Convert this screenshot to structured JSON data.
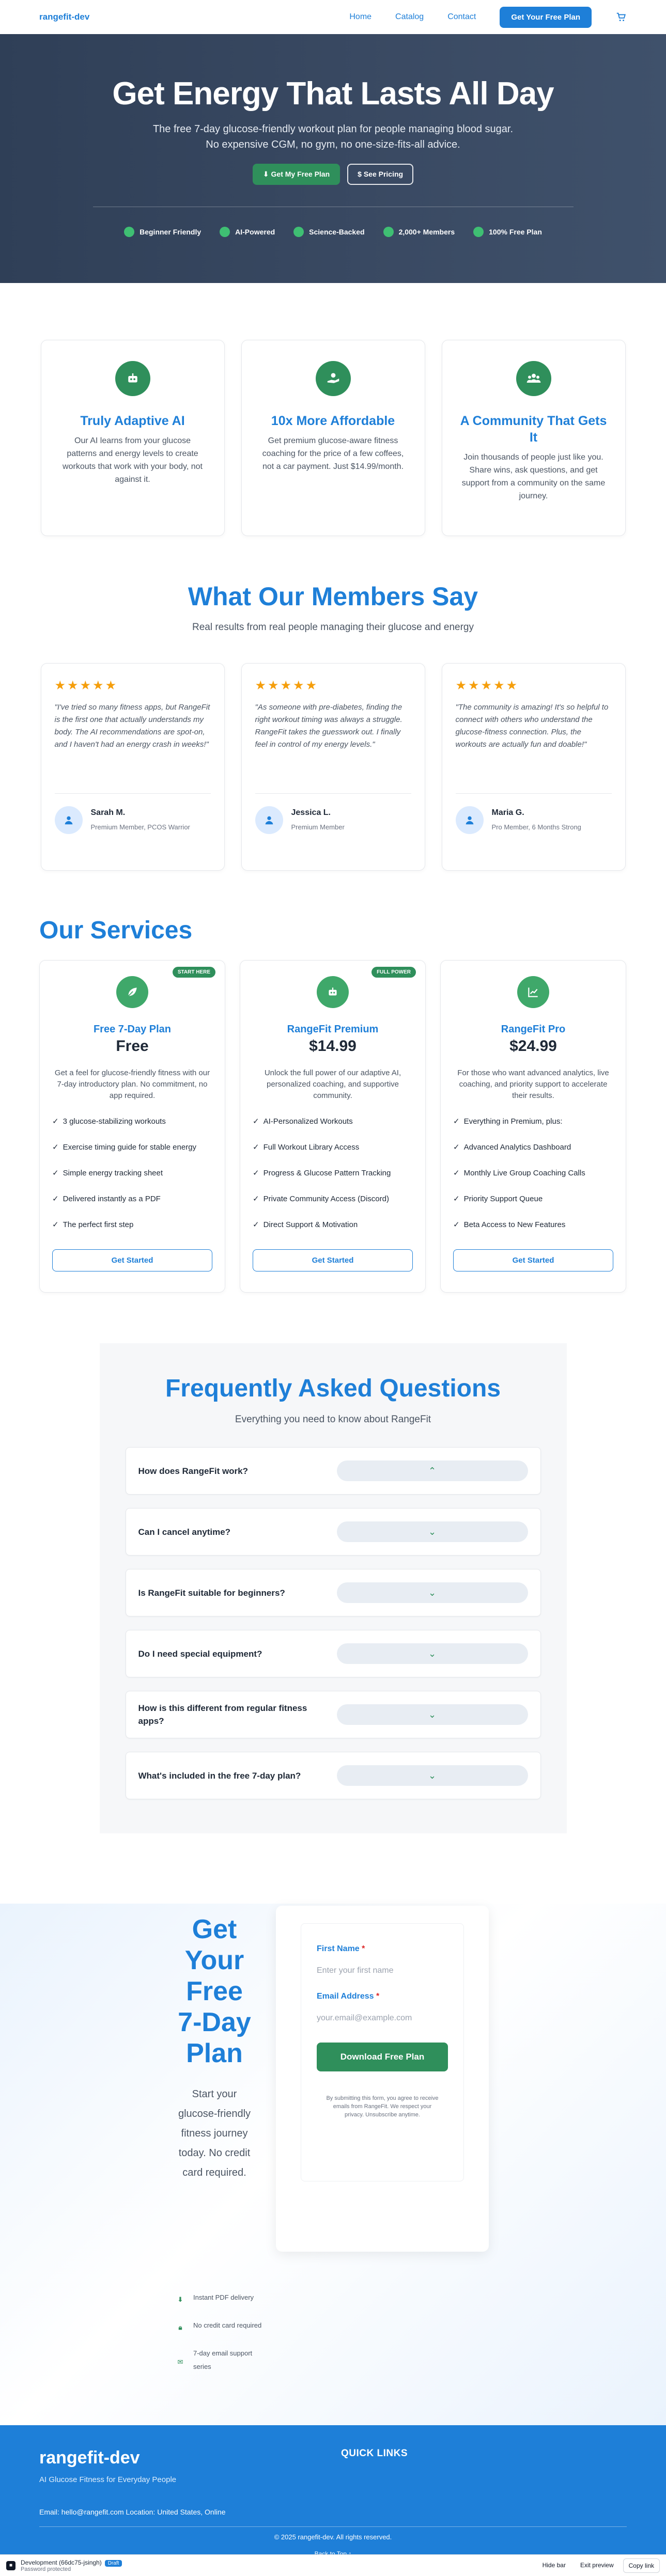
{
  "header": {
    "brand": "rangefit-dev",
    "nav": [
      "Home",
      "Catalog",
      "Contact"
    ],
    "cta": "Get Your Free Plan",
    "cart_icon": "cart-icon"
  },
  "hero": {
    "title": "Get Energy That Lasts All Day",
    "subtitle": "The free 7-day glucose-friendly workout plan for people managing blood sugar. No expensive CGM, no gym, no one-size-fits-all advice.",
    "primary_button": "⬇ Get My Free Plan",
    "secondary_button": "$ See Pricing",
    "badges": [
      "Beginner Friendly",
      "AI-Powered",
      "Science-Backed",
      "2,000+ Members",
      "100% Free Plan"
    ]
  },
  "features": [
    {
      "title": "Truly Adaptive AI",
      "text": "Our AI learns from your glucose patterns and energy levels to create workouts that work with your body, not against it.",
      "icon": "robot-icon"
    },
    {
      "title": "10x More Affordable",
      "text": "Get premium glucose-aware fitness coaching for the price of a few coffees, not a car payment. Just $14.99/month.",
      "icon": "hand-coin-icon"
    },
    {
      "title": "A Community That Gets It",
      "text": "Join thousands of people just like you. Share wins, ask questions, and get support from a community on the same journey.",
      "icon": "users-icon"
    }
  ],
  "testimonials": {
    "title": "What Our Members Say",
    "subtitle": "Real results from real people managing their glucose and energy",
    "stars": "★★★★★",
    "items": [
      {
        "quote": "\"I've tried so many fitness apps, but RangeFit is the first one that actually understands my body. The AI recommendations are spot-on, and I haven't had an energy crash in weeks!\"",
        "name": "Sarah M.",
        "role": "Premium Member, PCOS Warrior"
      },
      {
        "quote": "\"As someone with pre-diabetes, finding the right workout timing was always a struggle. RangeFit takes the guesswork out. I finally feel in control of my energy levels.\"",
        "name": "Jessica L.",
        "role": "Premium Member"
      },
      {
        "quote": "\"The community is amazing! It's so helpful to connect with others who understand the glucose-fitness connection. Plus, the workouts are actually fun and doable!\"",
        "name": "Maria G.",
        "role": "Pro Member, 6 Months Strong"
      }
    ]
  },
  "services": {
    "title": "Our Services",
    "cards": [
      {
        "ribbon": "START HERE",
        "name": "Free 7-Day Plan",
        "price": "Free",
        "desc": "Get a feel for glucose-friendly fitness with our 7-day introductory plan. No commitment, no app required.",
        "features": [
          "3 glucose-stabilizing workouts",
          "Exercise timing guide for stable energy",
          "Simple energy tracking sheet",
          "Delivered instantly as a PDF",
          "The perfect first step"
        ],
        "button": "Get Started",
        "icon": "leaf-icon"
      },
      {
        "ribbon": "FULL POWER",
        "name": "RangeFit Premium",
        "price": "$14.99",
        "desc": "Unlock the full power of our adaptive AI, personalized coaching, and supportive community.",
        "features": [
          "AI-Personalized Workouts",
          "Full Workout Library Access",
          "Progress & Glucose Pattern Tracking",
          "Private Community Access (Discord)",
          "Direct Support & Motivation"
        ],
        "button": "Get Started",
        "icon": "robot-icon"
      },
      {
        "ribbon": "",
        "name": "RangeFit Pro",
        "price": "$24.99",
        "desc": "For those who want advanced analytics, live coaching, and priority support to accelerate their results.",
        "features": [
          "Everything in Premium, plus:",
          "Advanced Analytics Dashboard",
          "Monthly Live Group Coaching Calls",
          "Priority Support Queue",
          "Beta Access to New Features"
        ],
        "button": "Get Started",
        "icon": "chart-line-icon"
      }
    ],
    "check": "✓"
  },
  "faq": {
    "title": "Frequently Asked Questions",
    "subtitle": "Everything you need to know about RangeFit",
    "items": [
      {
        "q": "How does RangeFit work?",
        "chevron": "⌃"
      },
      {
        "q": "Can I cancel anytime?",
        "chevron": "⌄"
      },
      {
        "q": "Is RangeFit suitable for beginners?",
        "chevron": "⌄"
      },
      {
        "q": "Do I need special equipment?",
        "chevron": "⌄"
      },
      {
        "q": "How is this different from regular fitness apps?",
        "chevron": "⌄"
      },
      {
        "q": "What's included in the free 7-day plan?",
        "chevron": "⌄"
      }
    ]
  },
  "signup": {
    "title": "Get Your Free 7-Day Plan",
    "text": "Start your glucose-friendly fitness journey today. No credit card required.",
    "first_name_label": "First Name",
    "first_name_placeholder": "Enter your first name",
    "email_label": "Email Address",
    "email_placeholder": "your.email@example.com",
    "required_mark": "*",
    "button": "Download Free Plan",
    "fine_print": "By submitting this form, you agree to receive emails from RangeFit. We respect your privacy. Unsubscribe anytime.",
    "perks": [
      {
        "text": "Instant PDF delivery",
        "icon": "download-icon"
      },
      {
        "text": "No credit card required",
        "icon": "lock-icon"
      },
      {
        "text": "7-day email support series",
        "icon": "mail-icon"
      }
    ]
  },
  "footer": {
    "brand": "rangefit-dev",
    "tagline": "AI Glucose Fitness for Everyday People",
    "quick_links": "QUICK LINKS",
    "contact": "Email: hello@rangefit.com Location: United States, Online",
    "copyright": "© 2025 rangefit-dev. All rights reserved.",
    "back_to_top": "Back to Top ↑"
  },
  "devbar": {
    "title": "Development (66dc75-jsingh)",
    "tag": "Draft",
    "subtitle": "Password protected",
    "hide": "Hide bar",
    "exit": "Exit preview",
    "copy": "Copy link"
  }
}
